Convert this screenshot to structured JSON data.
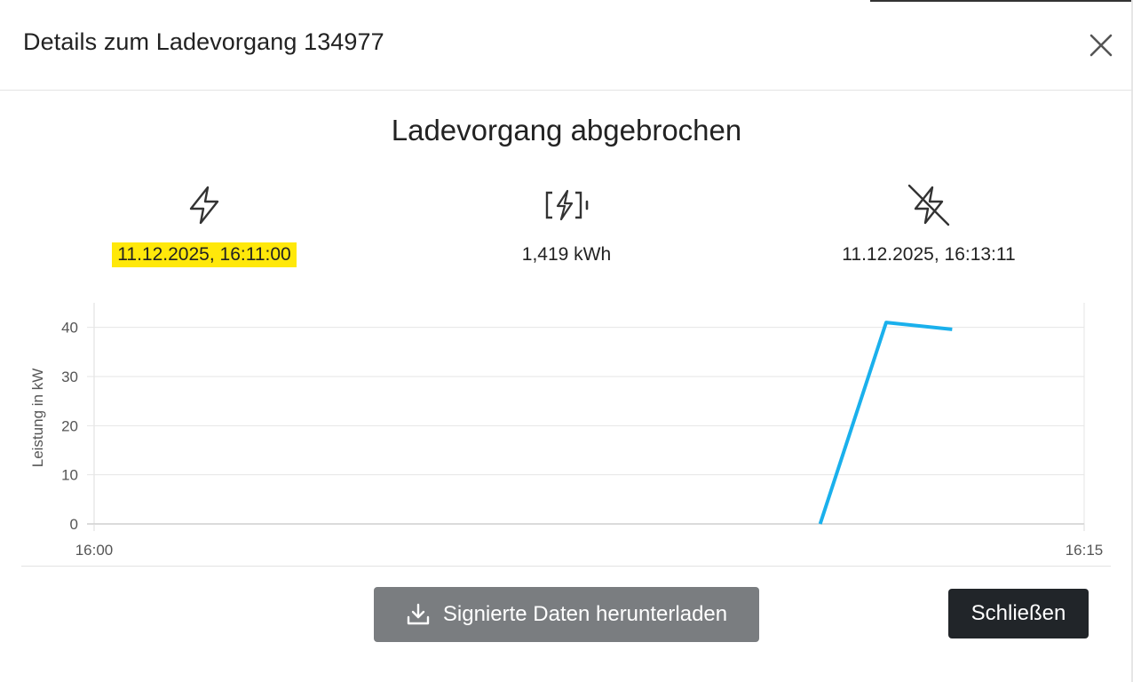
{
  "dialog": {
    "title": "Details zum Ladevorgang 134977",
    "close_icon": "close-icon"
  },
  "status": "Ladevorgang abgebrochen",
  "info": {
    "start": {
      "icon": "lightning-bolt-icon",
      "value": "11.12.2025, 16:11:00",
      "highlight_color": "#ffe80a"
    },
    "energy": {
      "icon": "battery-charging-icon",
      "value": "1,419 kWh"
    },
    "end": {
      "icon": "lightning-off-icon",
      "value": "11.12.2025, 16:13:11"
    }
  },
  "chart_data": {
    "type": "line",
    "ylabel": "Leistung in kW",
    "xlabel": "",
    "ylim": [
      0,
      45
    ],
    "yticks": [
      "0",
      "10",
      "20",
      "30",
      "40"
    ],
    "xticks": [
      "16:00",
      "16:15"
    ],
    "xlim_minutes": [
      0,
      15
    ],
    "series": [
      {
        "color": "#1ab0ec",
        "x": [
          "16:11:00",
          "16:12:00",
          "16:13:00"
        ],
        "x_minutes": [
          11.0,
          12.0,
          13.0
        ],
        "y": [
          0,
          41,
          39.6
        ]
      }
    ],
    "grid": true
  },
  "footer": {
    "download_icon": "download-icon",
    "download_label": "Signierte Daten herunterladen",
    "close_label": "Schließen"
  }
}
